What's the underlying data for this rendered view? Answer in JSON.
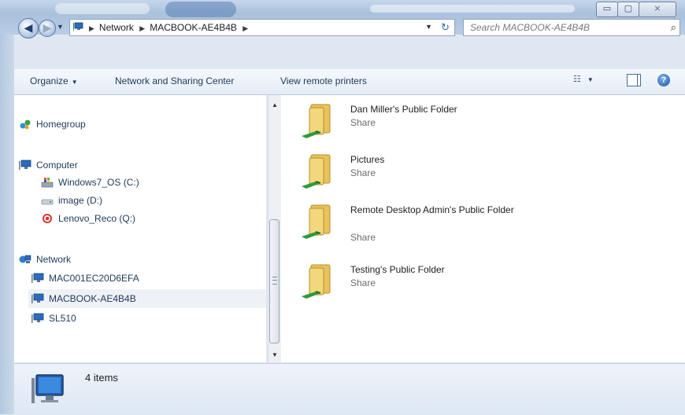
{
  "window": {
    "controls": {
      "minimize": "▭",
      "maximize": "▢",
      "close": "⨯"
    }
  },
  "address_bar": {
    "crumbs": [
      "Network",
      "MACBOOK-AE4B4B"
    ],
    "icon": "network-computer-icon"
  },
  "search": {
    "placeholder": "Search MACBOOK-AE4B4B"
  },
  "toolbar": {
    "organize": "Organize",
    "network_center": "Network and Sharing Center",
    "remote_printers": "View remote printers"
  },
  "navigation": {
    "homegroup": "Homegroup",
    "computer": "Computer",
    "drives": [
      "Windows7_OS (C:)",
      "image (D:)",
      "Lenovo_Reco (Q:)"
    ],
    "network": "Network",
    "network_items": [
      "MAC001EC20D6EFA",
      "MACBOOK-AE4B4B",
      "SL510"
    ],
    "selected": "MACBOOK-AE4B4B"
  },
  "shares": [
    {
      "name": "Dan Miller's Public Folder",
      "type": "Share"
    },
    {
      "name": "Pictures",
      "type": "Share"
    },
    {
      "name": "Remote Desktop Admin's Public Folder",
      "type": "Share"
    },
    {
      "name": "Testing's Public Folder",
      "type": "Share"
    }
  ],
  "details": {
    "count": "4 items"
  },
  "colors": {
    "accent": "#1e395b",
    "selection": "#eef1f5",
    "folder": "#e8c25a",
    "cable": "#2f9a3a"
  }
}
